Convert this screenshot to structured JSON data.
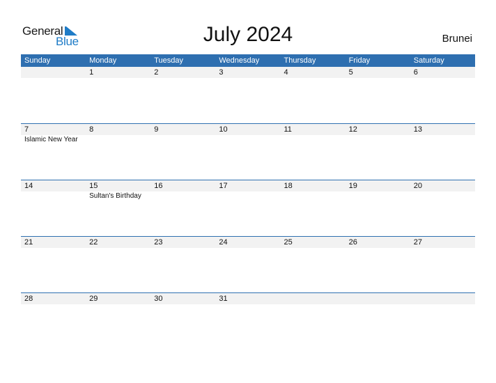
{
  "logo": {
    "word1": "General",
    "word2": "Blue"
  },
  "title": "July 2024",
  "country": "Brunei",
  "colors": {
    "header_bg": "#2e6fb0",
    "date_row_bg": "#f2f2f2",
    "logo_blue": "#1f7cc7"
  },
  "weekdays": [
    "Sunday",
    "Monday",
    "Tuesday",
    "Wednesday",
    "Thursday",
    "Friday",
    "Saturday"
  ],
  "weeks": [
    {
      "days": [
        "",
        "1",
        "2",
        "3",
        "4",
        "5",
        "6"
      ],
      "events": [
        "",
        "",
        "",
        "",
        "",
        "",
        ""
      ]
    },
    {
      "days": [
        "7",
        "8",
        "9",
        "10",
        "11",
        "12",
        "13"
      ],
      "events": [
        "Islamic New Year",
        "",
        "",
        "",
        "",
        "",
        ""
      ]
    },
    {
      "days": [
        "14",
        "15",
        "16",
        "17",
        "18",
        "19",
        "20"
      ],
      "events": [
        "",
        "Sultan's Birthday",
        "",
        "",
        "",
        "",
        ""
      ]
    },
    {
      "days": [
        "21",
        "22",
        "23",
        "24",
        "25",
        "26",
        "27"
      ],
      "events": [
        "",
        "",
        "",
        "",
        "",
        "",
        ""
      ]
    },
    {
      "days": [
        "28",
        "29",
        "30",
        "31",
        "",
        "",
        ""
      ],
      "events": [
        "",
        "",
        "",
        "",
        "",
        "",
        ""
      ]
    }
  ]
}
